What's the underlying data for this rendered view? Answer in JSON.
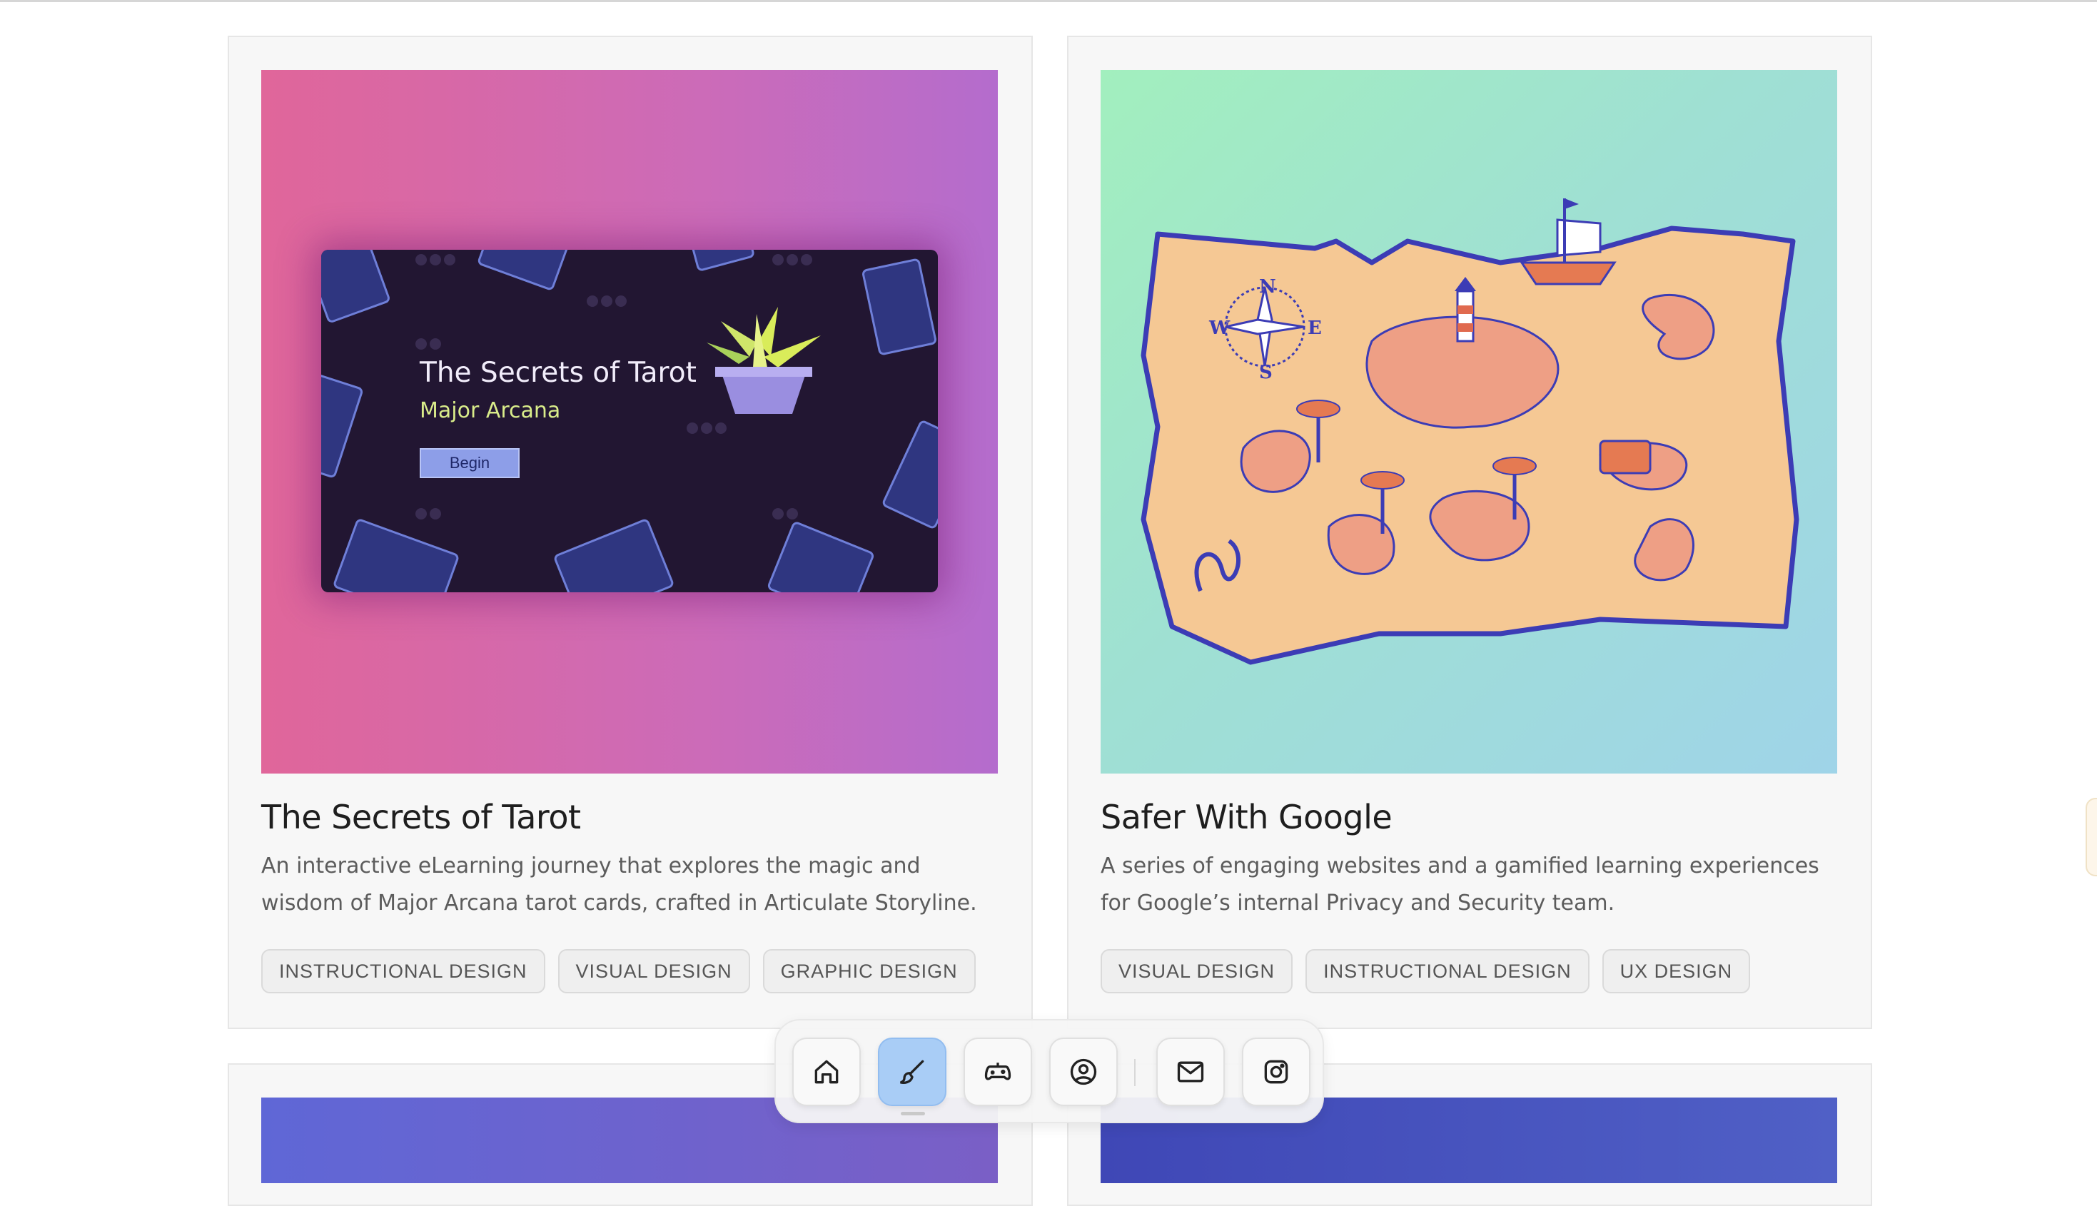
{
  "projects": [
    {
      "title": "The Secrets of Tarot",
      "description": "An interactive eLearning journey that explores the magic and wisdom of Major Arcana tarot cards, crafted in Articulate Storyline.",
      "tags": [
        "INSTRUCTIONAL DESIGN",
        "VISUAL DESIGN",
        "GRAPHIC DESIGN"
      ],
      "thumbnail": {
        "screen_title": "The Secrets of Tarot",
        "screen_subtitle": "Major Arcana",
        "screen_button": "Begin"
      }
    },
    {
      "title": "Safer With Google",
      "description": "A series of engaging websites and a gamified learning experiences for Google’s internal Privacy and Security team.",
      "tags": [
        "VISUAL DESIGN",
        "INSTRUCTIONAL DESIGN",
        "UX DESIGN"
      ],
      "thumbnail": {
        "compass_n": "N",
        "compass_e": "E",
        "compass_s": "S",
        "compass_w": "W"
      }
    }
  ],
  "dock": {
    "items": [
      {
        "icon": "home-icon",
        "active": false
      },
      {
        "icon": "brush-icon",
        "active": true
      },
      {
        "icon": "gamepad-icon",
        "active": false
      },
      {
        "icon": "user-circle-icon",
        "active": false
      },
      {
        "icon": "mail-icon",
        "active": false
      },
      {
        "icon": "instagram-icon",
        "active": false
      }
    ]
  },
  "colors": {
    "tarot_gradient": [
      "#e0669a",
      "#b46ccd"
    ],
    "google_gradient": [
      "#a2efbe",
      "#9fd4e8"
    ],
    "dock_active": "#a9cdf6"
  }
}
